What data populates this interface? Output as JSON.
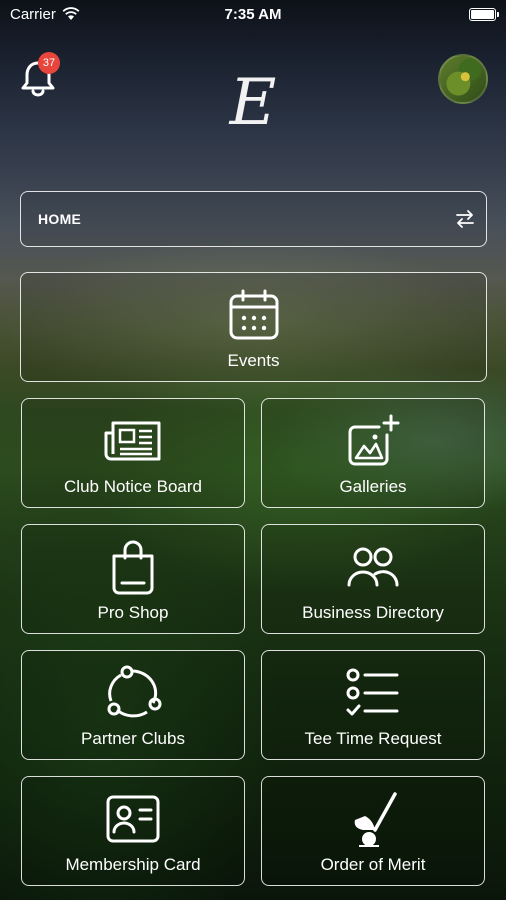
{
  "status_bar": {
    "carrier": "Carrier",
    "time": "7:35 AM"
  },
  "header": {
    "notification_count": "37",
    "logo_letter": "E"
  },
  "home_bar": {
    "label": "HOME"
  },
  "tiles": {
    "events": "Events",
    "club_notice_board": "Club Notice Board",
    "galleries": "Galleries",
    "pro_shop": "Pro Shop",
    "business_directory": "Business Directory",
    "partner_clubs": "Partner Clubs",
    "tee_time_request": "Tee Time Request",
    "membership_card": "Membership Card",
    "order_of_merit": "Order of Merit"
  },
  "icons": {
    "bell": "bell-icon",
    "wifi": "wifi-icon",
    "battery": "battery-icon",
    "swap": "swap-icon",
    "calendar": "calendar-icon",
    "newspaper": "newspaper-icon",
    "gallery": "add-photo-icon",
    "bag": "shopping-bag-icon",
    "people": "people-icon",
    "network": "network-icon",
    "checklist": "checklist-icon",
    "id_card": "id-card-icon",
    "golf": "golf-club-icon"
  },
  "colors": {
    "badge": "#e8453c",
    "text": "#ffffff"
  }
}
